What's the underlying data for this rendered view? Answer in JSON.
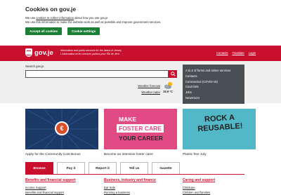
{
  "cookie": {
    "title": "Cookies on gov.je",
    "line1_pre": "We use ",
    "line1_link": "cookies to collect information",
    "line1_post": " about how you use gov.je",
    "line2": "We use this information to make the website work as well as possible and improve government services.",
    "accept_label": "Accept all cookies",
    "settings_label": "Cookie settings"
  },
  "header": {
    "logo_text": "gov.je",
    "tagline_en": "Information and public services for the Island of Jersey",
    "tagline_fr": "L'information et les services publics pour l'Île de Jèrri",
    "links": [
      "Contacts",
      "Translate",
      "Login"
    ]
  },
  "search": {
    "label": "Search gov.je",
    "placeholder": ""
  },
  "weather": {
    "forecast_link": "Weather forecast",
    "radar_link": "Weather radar",
    "temperature": "15.9 °C"
  },
  "quicklinks": [
    "A to Z of forms and online services",
    "Contacts",
    "Coronavirus (COVID-19)",
    "Court lists",
    "Jobs",
    "Newsroom"
  ],
  "cards": [
    {
      "caption": "Apply for the Community Cost Bonus",
      "image_text": "€"
    },
    {
      "caption": "Become an intensive foster carer",
      "image_text": [
        "MAKE",
        "FOSTER CARE",
        "YOUR CAREER"
      ]
    },
    {
      "caption": "Plastic free July",
      "image_text": "ROCK A REUSABLE!"
    }
  ],
  "tabs": [
    "Browse",
    "Pay it",
    "Report it",
    "Tell us",
    "Gazette"
  ],
  "columns": [
    {
      "heading": "Benefits and financial support",
      "items": [
        "Income Support",
        "Benefits and financial support"
      ]
    },
    {
      "heading": "Business, industry and finance",
      "items": [
        "Eat Safe",
        "Running a business"
      ]
    },
    {
      "heading": "Caring and support",
      "items": [
        "Childcare",
        "Children and families"
      ]
    }
  ],
  "colors": {
    "brand_red": "#c8102e",
    "accept_green": "#1a7f35",
    "quicklinks_bg": "#4a4f54"
  }
}
